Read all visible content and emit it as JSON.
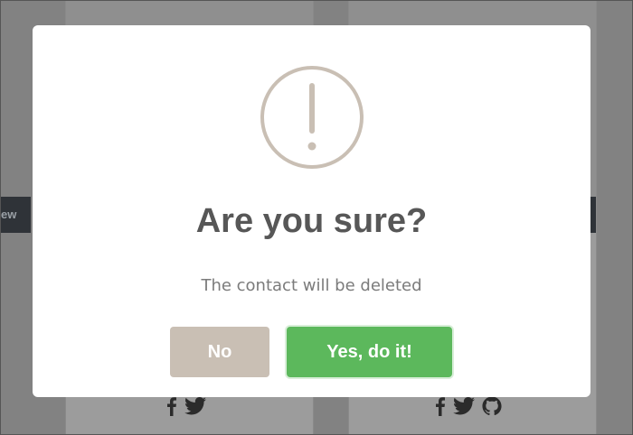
{
  "background": {
    "tag_text": "ew"
  },
  "dialog": {
    "title": "Are you sure?",
    "message": "The contact will be deleted",
    "no_label": "No",
    "yes_label": "Yes, do it!"
  },
  "colors": {
    "icon": "#c9bfb4",
    "no_button": "#c9bfb4",
    "yes_button": "#5cb85c",
    "title": "#575757",
    "message": "#7b7b7b"
  },
  "icons": [
    "warning-icon",
    "facebook-icon",
    "twitter-icon",
    "github-icon"
  ]
}
